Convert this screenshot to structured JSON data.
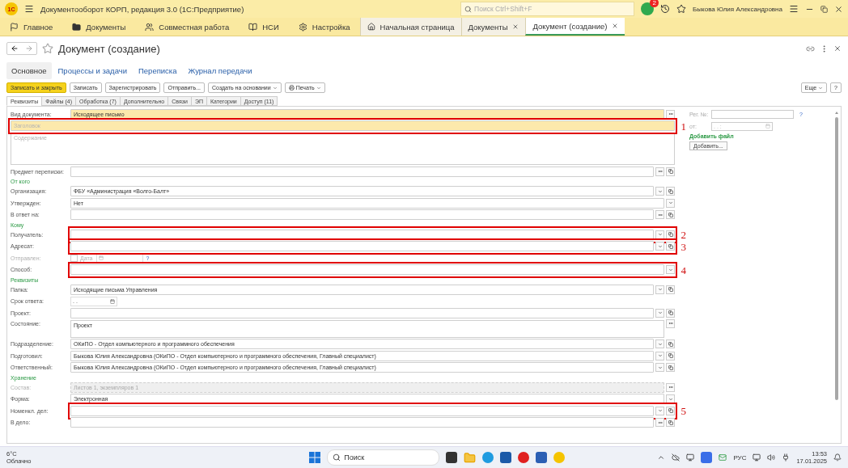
{
  "window": {
    "logo": "1С",
    "title": "Документооборот КОРП, редакция 3.0  (1С:Предприятие)",
    "search": {
      "placeholder": "Поиск Ctrl+Shift+F"
    },
    "notifications": "2",
    "user": "Быкова Юлия Александровна"
  },
  "sections": [
    {
      "label": "Главное"
    },
    {
      "label": "Документы"
    },
    {
      "label": "Совместная работа"
    },
    {
      "label": "НСИ"
    },
    {
      "label": "Настройка"
    }
  ],
  "open_tabs": [
    {
      "label": "Начальная страница",
      "kind": "home",
      "selected": false
    },
    {
      "label": "Документы",
      "kind": "closable",
      "selected": false
    },
    {
      "label": "Документ (создание)",
      "kind": "closable",
      "selected": true
    }
  ],
  "form": {
    "title": "Документ (создание)",
    "nav": [
      {
        "label": "Основное",
        "selected": true
      },
      {
        "label": "Процессы и задачи",
        "selected": false
      },
      {
        "label": "Переписка",
        "selected": false
      },
      {
        "label": "Журнал передачи",
        "selected": false
      }
    ],
    "commands": [
      {
        "label": "Записать и закрыть",
        "kind": "primary"
      },
      {
        "label": "Записать",
        "kind": "plain"
      },
      {
        "label": "Зарегистрировать",
        "kind": "plain"
      },
      {
        "label": "Отправить...",
        "kind": "plain"
      },
      {
        "label": "Создать на основании",
        "kind": "menu"
      },
      {
        "label": "Печать",
        "kind": "print"
      }
    ],
    "extra_commands": [
      {
        "label": "Еще",
        "kind": "menu"
      },
      {
        "label": "?",
        "kind": "plain"
      }
    ],
    "tabs": [
      {
        "label": "Реквизиты",
        "selected": true
      },
      {
        "label": "Файлы (4)",
        "selected": false
      },
      {
        "label": "Обработка (7)",
        "selected": false
      },
      {
        "label": "Дополнительно",
        "selected": false
      },
      {
        "label": "Связи",
        "selected": false
      },
      {
        "label": "ЭП",
        "selected": false
      },
      {
        "label": "Категории",
        "selected": false
      },
      {
        "label": "Доступ (11)",
        "selected": false
      }
    ],
    "fields": [
      {
        "kind": "text",
        "label": "Вид документа:",
        "value": "Исходящее письмо",
        "highlighted": true,
        "disabled": false
      },
      {
        "kind": "input",
        "placeholder": "Заголовок",
        "highlighted": true,
        "disabled": false,
        "marker": "1"
      },
      {
        "kind": "memo",
        "placeholder": "Содержание"
      },
      {
        "kind": "picker",
        "label": "Предмет переписки:",
        "highlighted": false,
        "disabled": false
      },
      {
        "kind": "section",
        "label": "От кого"
      },
      {
        "kind": "choice",
        "label": "Организация:",
        "value": "ФБУ «Администрация «Волго-Балт»",
        "highlighted": false,
        "disabled": false
      },
      {
        "kind": "list",
        "label": "Утвержден:",
        "value": "Нет",
        "highlighted": false,
        "disabled": false
      },
      {
        "kind": "picker",
        "label": "В ответ на:",
        "highlighted": false,
        "disabled": false
      },
      {
        "kind": "section",
        "label": "Кому"
      },
      {
        "kind": "choice",
        "label": "Получатель:",
        "highlighted": false,
        "disabled": false,
        "marker": "2"
      },
      {
        "kind": "choice",
        "label": "Адресат:",
        "highlighted": false,
        "disabled": false,
        "marker": "3"
      },
      {
        "kind": "sent",
        "label": "Отправлен:",
        "checked": false,
        "date_label": "Дата",
        "hint": "?"
      },
      {
        "kind": "list",
        "label": "Способ:",
        "highlighted": false,
        "disabled": false,
        "marker": "4"
      },
      {
        "kind": "section",
        "label": "Реквизиты"
      },
      {
        "kind": "choice",
        "label": "Папка:",
        "value": "Исходящие письма Управления",
        "highlighted": false,
        "disabled": false
      },
      {
        "kind": "date",
        "label": "Срок ответа:",
        "value": ". ."
      },
      {
        "kind": "choice",
        "label": "Проект:",
        "highlighted": false,
        "disabled": false
      },
      {
        "kind": "textarea",
        "label": "Состояние:",
        "value": "Проект"
      },
      {
        "kind": "choice",
        "label": "Подразделение:",
        "value": "ОКиПО - Отдел компьютерного и программного обеспечения",
        "highlighted": false,
        "disabled": false
      },
      {
        "kind": "choice",
        "label": "Подготовил:",
        "value": "Быкова Юлия Александровна (ОКиПО - Отдел компьютерного и программного обеспечения, Главный специалист)",
        "highlighted": false,
        "disabled": false
      },
      {
        "kind": "choice",
        "label": "Ответственный:",
        "value": "Быкова Юлия Александровна (ОКиПО - Отдел компьютерного и программного обеспечения, Главный специалист)",
        "highlighted": false,
        "disabled": false
      },
      {
        "kind": "section",
        "label": "Хранение"
      },
      {
        "kind": "text",
        "label": "Состав:",
        "value": "Листов 1, экземпляров 1",
        "highlighted": false,
        "disabled": true
      },
      {
        "kind": "list",
        "label": "Форма:",
        "value": "Электронная",
        "highlighted": false,
        "disabled": false
      },
      {
        "kind": "choice",
        "label": "Номенкл. дел:",
        "highlighted": false,
        "disabled": false,
        "marker": "5"
      },
      {
        "kind": "picker",
        "label": "В дело:",
        "highlighted": false,
        "disabled": false
      }
    ],
    "side": {
      "reg_label": "Рег. №:",
      "reg_hint": "?",
      "date_label": "от:",
      "date_value": ". .  :",
      "files_title": "Добавить файл",
      "add_button": "Добавить..."
    }
  },
  "taskbar": {
    "temperature": "6°C",
    "weather": "Облачно",
    "search": "Поиск",
    "language": "РУС",
    "time": "13:53",
    "date": "17.01.2025"
  }
}
